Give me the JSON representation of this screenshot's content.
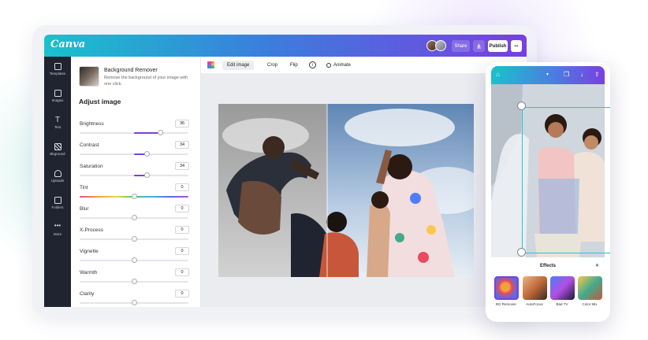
{
  "brand": {
    "logo": "Canva",
    "accent": "#7b3fe0",
    "gradient": [
      "#19c2cc",
      "#3a7fdc",
      "#7a3fe0"
    ]
  },
  "topbar": {
    "share_label": "Share",
    "download_icon": "download-icon",
    "publish_label": "Publish",
    "more_label": "•••"
  },
  "sidebar": {
    "items": [
      {
        "label": "Templates",
        "icon": "templates-icon"
      },
      {
        "label": "Images",
        "icon": "image-icon"
      },
      {
        "label": "Text",
        "icon": "text-icon"
      },
      {
        "label": "Bkground",
        "icon": "background-icon"
      },
      {
        "label": "Uploads",
        "icon": "upload-icon"
      },
      {
        "label": "Folders",
        "icon": "folder-icon"
      },
      {
        "label": "More",
        "icon": "more-icon"
      }
    ]
  },
  "panel": {
    "bg_remover_title": "Background Remover",
    "bg_remover_desc": "Remove the background of your image with one click.",
    "adjust_title": "Adjust image",
    "sliders": [
      {
        "label": "Brightness",
        "value": "36"
      },
      {
        "label": "Contrast",
        "value": "34"
      },
      {
        "label": "Saturation",
        "value": "34"
      },
      {
        "label": "Tint",
        "value": "0"
      },
      {
        "label": "Blur",
        "value": "0"
      },
      {
        "label": "X-Process",
        "value": "0"
      },
      {
        "label": "Vignette",
        "value": "0"
      },
      {
        "label": "Warmth",
        "value": "0"
      },
      {
        "label": "Clarity",
        "value": "0"
      }
    ]
  },
  "toolbar": {
    "edit_image": "Edit image",
    "crop": "Crop",
    "flip": "Flip",
    "info": "i",
    "animate": "Animate"
  },
  "phone": {
    "effects_title": "Effects",
    "close": "✕",
    "effects": [
      {
        "label": "BG Remover"
      },
      {
        "label": "AutoFocus"
      },
      {
        "label": "Bad TV"
      },
      {
        "label": "Color Mix"
      }
    ]
  }
}
